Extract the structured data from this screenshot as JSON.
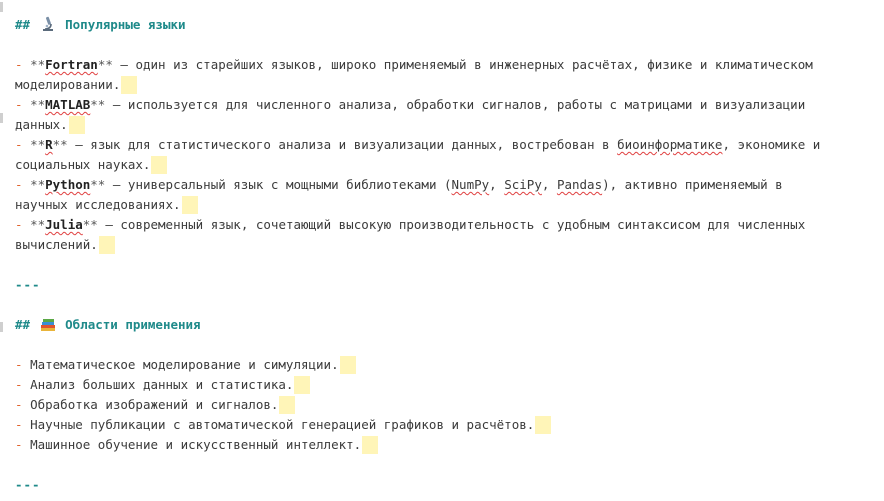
{
  "section_langs": {
    "hashes": "##",
    "title": "Популярные языки",
    "icon": "microscope-icon"
  },
  "langs": [
    {
      "name": "Fortran",
      "l1": " — один из старейших языков, широко применяемый в инженерных расчётах, физике и климатическом",
      "l2": "моделировании."
    },
    {
      "name": "MATLAB",
      "l1": " — используется для численного анализа, обработки сигналов, работы с матрицами и визуализации",
      "l2": "данных."
    },
    {
      "name": "R",
      "l1a": " — язык для статистического анализа и визуализации данных, востребован в ",
      "l1b": "биоинформатике",
      "l1c": ", экономике и",
      "l2": "социальных науках."
    },
    {
      "name": "Python",
      "l1a": " — универсальный язык с мощными библиотеками (",
      "lib1": "NumPy",
      "sep": ", ",
      "lib2": "SciPy",
      "lib3": "Pandas",
      "l1c": "), активно применяемый в",
      "l2": "научных исследованиях."
    },
    {
      "name": "Julia",
      "l1": " — современный язык, сочетающий высокую производительность с удобным синтаксисом для численных",
      "l2": "вычислений."
    }
  ],
  "markers": {
    "dash": "-",
    "bold": "**",
    "hr": "---"
  },
  "section_areas": {
    "hashes": "##",
    "title": "Области применения",
    "icon": "books-icon"
  },
  "areas": [
    "Математическое моделирование и симуляции.",
    "Анализ больших данных и статистика.",
    "Обработка изображений и сигналов.",
    "Научные публикации с автоматической генерацией графиков и расчётов.",
    "Машинное обучение и искусственный интеллект."
  ]
}
